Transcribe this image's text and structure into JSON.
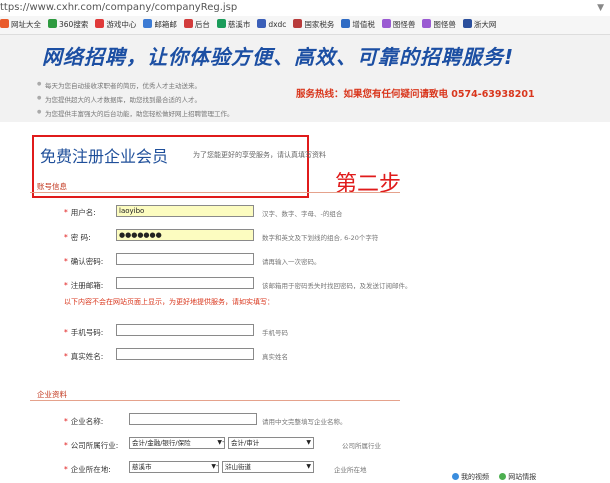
{
  "browser": {
    "url": "ttps://www.cxhr.com/company/companyReg.jsp",
    "bookmarks": [
      {
        "label": "网址大全",
        "color": "#e95b2b"
      },
      {
        "label": "360搜索",
        "color": "#2e9a3f"
      },
      {
        "label": "游戏中心",
        "color": "#e03a3a"
      },
      {
        "label": "邮箱邮",
        "color": "#3c7bd4"
      },
      {
        "label": "后台",
        "color": "#d23c3c"
      },
      {
        "label": "慈溪市",
        "color": "#1a9c5a"
      },
      {
        "label": "dxdc",
        "color": "#3b5fb8"
      },
      {
        "label": "国家税务",
        "color": "#b83b3b"
      },
      {
        "label": "增值税",
        "color": "#2f6bc4"
      },
      {
        "label": "图怪兽",
        "color": "#9a5ad2"
      },
      {
        "label": "图怪兽",
        "color": "#9a5ad2"
      },
      {
        "label": "浙大网",
        "color": "#2b4f9c"
      }
    ],
    "status": {
      "video": "我的视频",
      "news": "网站情报"
    }
  },
  "banner": {
    "slogan": "网络招聘，让你体验方便、高效、可靠的招聘服务!",
    "bullets": [
      "每天为您自动接收求职者的简历，优秀人才主动送来。",
      "为您提供超大的人才数据库，助您找到最合适的人才。",
      "为您提供丰富强大的后台功能，助您轻松做好网上招聘管理工作。"
    ],
    "hotline": "服务热线：如果您有任何疑问请致电   0574-63938201"
  },
  "heading": {
    "title": "免费注册企业会员",
    "subtitle": "为了您能更好的享受服务，请认真填写资料",
    "step": "第二步"
  },
  "account": {
    "section": "账号信息",
    "fields": [
      {
        "label": "用户名:",
        "value": "laoyibo",
        "hint": "汉字、数字、字母、-的组合"
      },
      {
        "label": "密    码:",
        "value": "●●●●●●●",
        "hint": "数字和英文及下划线的组合, 6-20个字符"
      },
      {
        "label": "确认密码:",
        "value": "",
        "hint": "请再输入一次密码。"
      },
      {
        "label": "注册邮箱:",
        "value": "",
        "hint": "该邮箱用于密码丢失时找回密码，及发送订阅邮件。"
      }
    ],
    "warning": "以下内容不会在网站页面上显示，为更好地提供服务，请如实填写：",
    "contact": [
      {
        "label": "手机号码:",
        "value": "",
        "hint": "手机号码"
      },
      {
        "label": "真实姓名:",
        "value": "",
        "hint": "真实姓名"
      }
    ]
  },
  "company": {
    "section": "企业资料",
    "name_label": "企业名称:",
    "name_value": "",
    "name_hint": "请用中文完整填写企业名称。",
    "industry_label": "公司所属行业:",
    "industry_1": "会计/金融/银行/保险",
    "industry_2": "会计/审计",
    "industry_hint": "公司所属行业",
    "location_label": "企业所在地:",
    "location_1": "慈溪市",
    "location_2": "浒山街道",
    "location_hint": "企业所在地"
  }
}
